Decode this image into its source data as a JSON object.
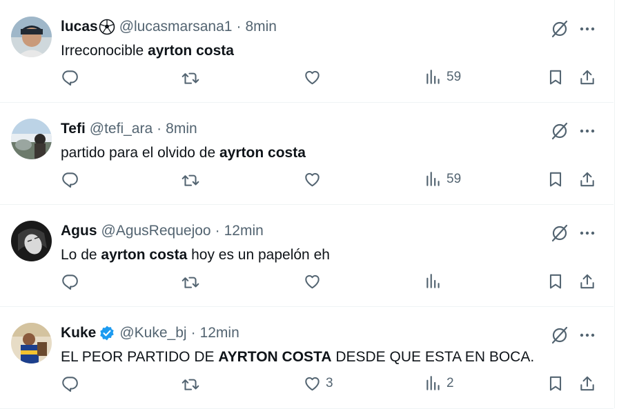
{
  "tweets": [
    {
      "name": "lucas",
      "handle": "@lucasmarsana1",
      "time": "8min",
      "text_pre": "Irreconocible ",
      "text_bold": "ayrton costa",
      "text_post": "",
      "has_emoji": true,
      "verified": false,
      "replies": "",
      "retweets": "",
      "likes": "",
      "views": "59"
    },
    {
      "name": "Tefi",
      "handle": "@tefi_ara",
      "time": "8min",
      "text_pre": "partido para el olvido de ",
      "text_bold": "ayrton costa",
      "text_post": "",
      "has_emoji": false,
      "verified": false,
      "replies": "",
      "retweets": "",
      "likes": "",
      "views": "59"
    },
    {
      "name": "Agus",
      "handle": "@AgusRequejoo",
      "time": "12min",
      "text_pre": "Lo de ",
      "text_bold": "ayrton costa",
      "text_post": " hoy es un papelón eh",
      "has_emoji": false,
      "verified": false,
      "replies": "",
      "retweets": "",
      "likes": "",
      "views": ""
    },
    {
      "name": "Kuke",
      "handle": "@Kuke_bj",
      "time": "12min",
      "text_pre": "EL PEOR PARTIDO DE ",
      "text_bold": "AYRTON COSTA",
      "text_post": " DESDE QUE ESTA EN BOCA.",
      "has_emoji": false,
      "verified": true,
      "replies": "",
      "retweets": "",
      "likes": "3",
      "views": "2"
    }
  ],
  "header_separator": "·",
  "colors": {
    "text": "#0f1419",
    "secondary": "#536471",
    "verified": "#1d9bf0",
    "divider": "#eff3f4"
  }
}
